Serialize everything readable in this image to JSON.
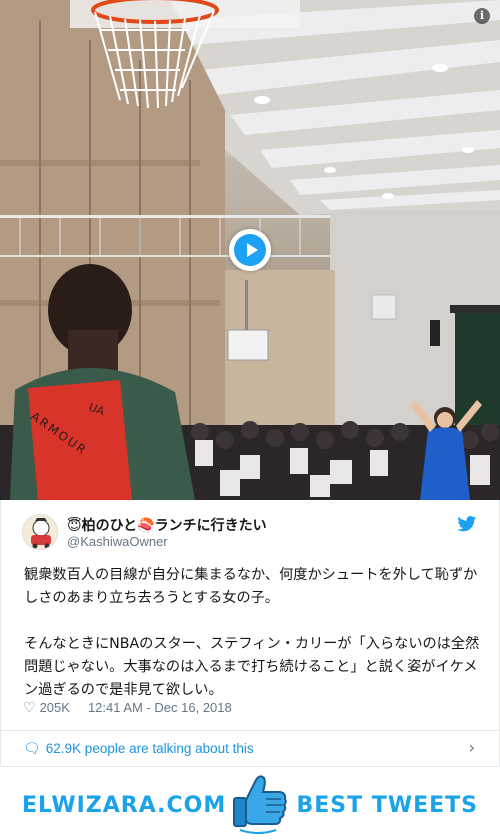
{
  "video": {
    "shirt_text_1": "UA",
    "shirt_text_2": "ARMOUR",
    "info_icon": "i",
    "play_icon": "play-icon"
  },
  "tweet": {
    "display_name": "😇柏のひと🍣ランチに行きたい",
    "handle": "@KashiwaOwner",
    "text_paragraph_1": "観衆数百人の目線が自分に集まるなか、何度かシュートを外して恥ずかしさのあまり立ち去ろうとする女の子。",
    "text_paragraph_2": "そんなときにNBAのスター、ステフィン・カリーが「入らないのは全然問題じゃない。大事なのは入るまで打ち続けること」と説く姿がイケメン過ぎるので是非見て欲しい。",
    "likes": "205K",
    "timestamp": "12:41 AM - Dec 16, 2018",
    "heart_icon": "heart-icon",
    "bird_icon": "twitter-bird-icon"
  },
  "conversation": {
    "label": "62.9K people are talking about this",
    "bubble_icon": "speech-bubble-icon",
    "chevron_icon": "chevron-right-icon"
  },
  "footer": {
    "left_brand": "ELWIZARA.COM",
    "right_brand": "BEST TWEETS",
    "center_icon": "thumbs-up-icon"
  },
  "colors": {
    "twitter_blue": "#1da1f2",
    "link_blue": "#1b95e0",
    "brand_blue": "#1aa3e8",
    "muted_gray": "#657786"
  }
}
